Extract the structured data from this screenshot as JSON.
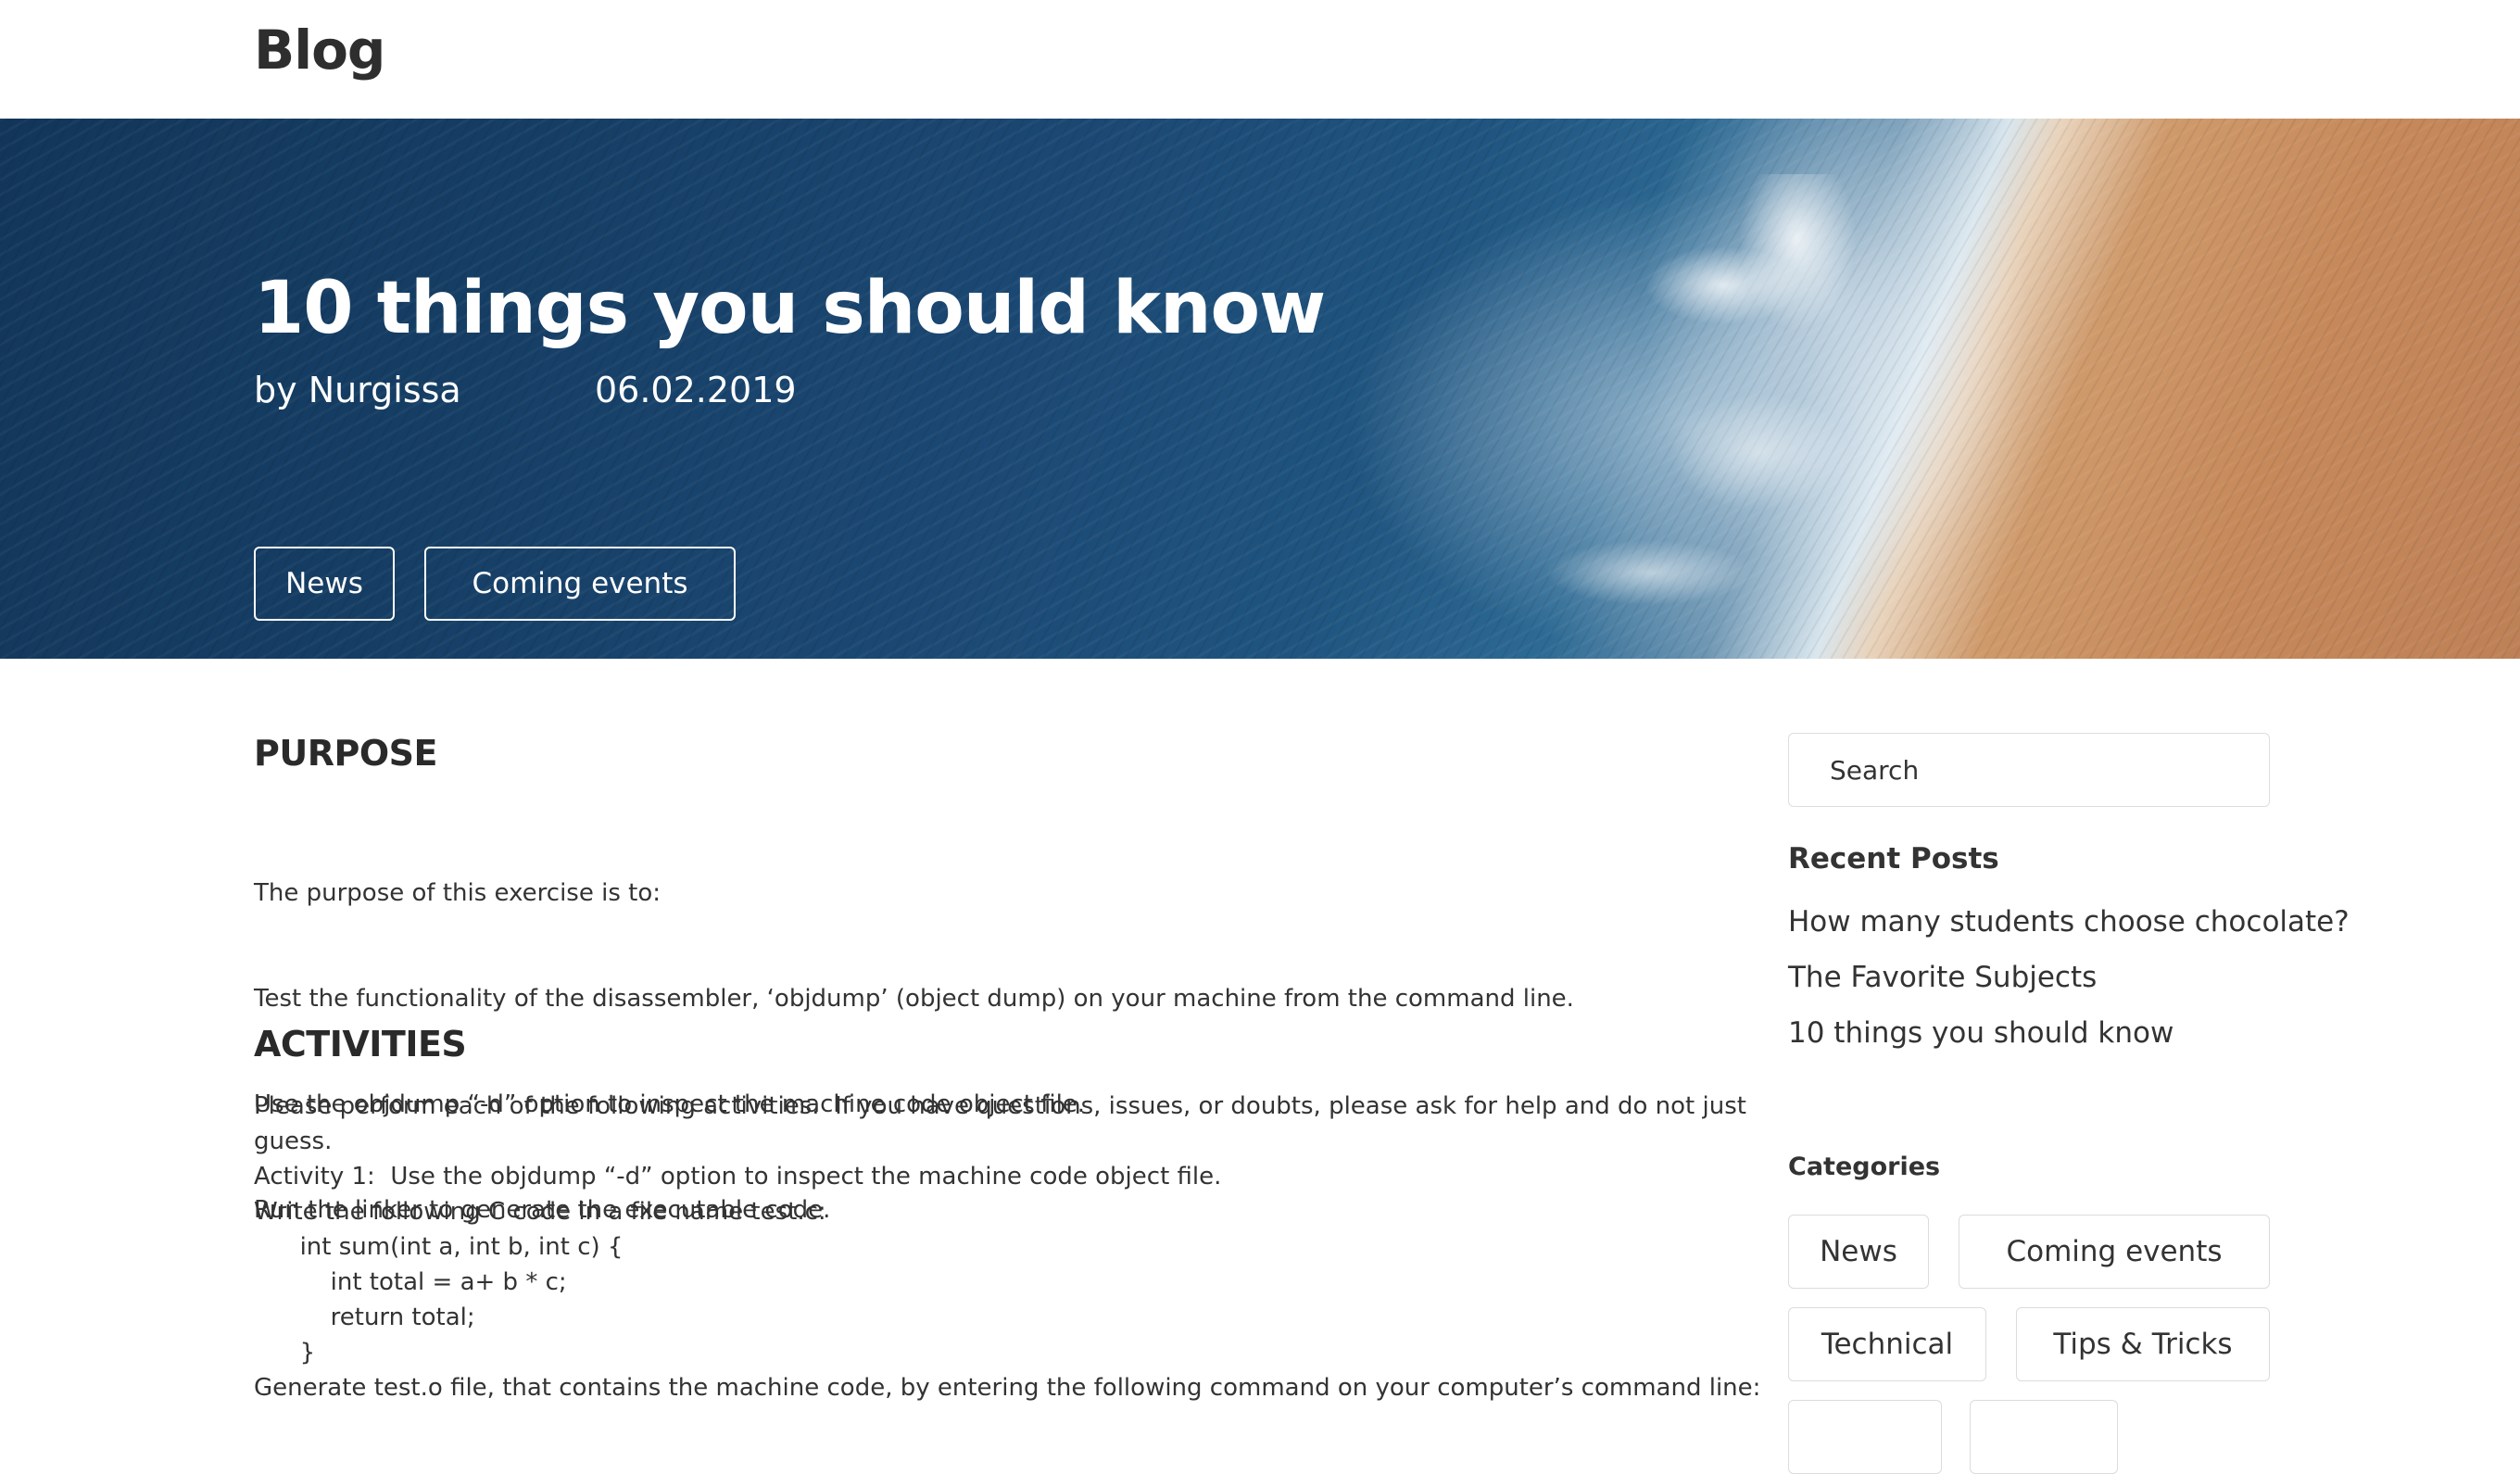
{
  "header": {
    "logo": "Blog"
  },
  "hero": {
    "title": "10 things you should know",
    "author": "by Nurgissa",
    "date": "06.02.2019",
    "tags": [
      "News",
      "Coming events"
    ]
  },
  "main": {
    "purpose_heading": "PURPOSE",
    "purpose_lines": [
      "The purpose of this exercise is to:",
      "Test the functionality of the disassembler, ‘objdump’ (object dump) on your machine from the command line.",
      "Use the objdump “-d” option to inspect the machine code object file.",
      "Run the linker to generate the executable code."
    ],
    "activities_heading": "ACTIVITIES",
    "activities_lines": [
      "Please perform each of the following activities.  If you have questions, issues, or doubts, please ask for help and do not just",
      "guess.",
      "Activity 1:  Use the objdump “-d” option to inspect the machine code object file.",
      "Write the following C code in a file name test.c:",
      "      int sum(int a, int b, int c) {",
      "          int total = a+ b * c;",
      "          return total;",
      "      }",
      "Generate test.o file, that contains the machine code, by entering the following command on your computer’s command line:"
    ]
  },
  "sidebar": {
    "search_placeholder": "Search",
    "recent_heading": "Recent Posts",
    "recent_posts": [
      "How many students choose chocolate?",
      "The Favorite Subjects",
      "10 things you should know"
    ],
    "categories_heading": "Categories",
    "categories": [
      "News",
      "Coming events",
      "Technical",
      "Tips & Tricks",
      "",
      ""
    ]
  }
}
